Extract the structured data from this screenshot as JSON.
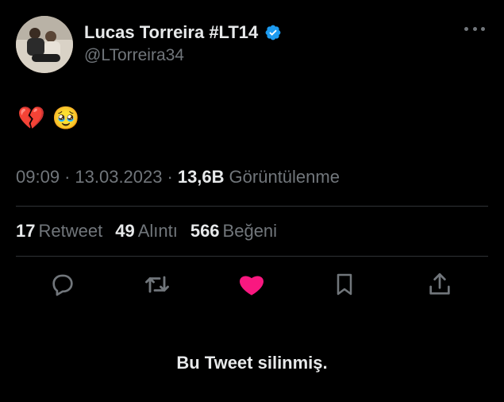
{
  "author": {
    "name": "Lucas Torreira #LT14",
    "handle": "@LTorreira34",
    "verified_color": "#1d9bf0"
  },
  "tweet": {
    "text": "💔 🥹",
    "time": "09:09",
    "date": "13.03.2023",
    "views_count": "13,6B",
    "views_label": "Görüntülenme"
  },
  "stats": {
    "retweets": {
      "count": "17",
      "label": "Retweet"
    },
    "quotes": {
      "count": "49",
      "label": "Alıntı"
    },
    "likes": {
      "count": "566",
      "label": "Beğeni"
    }
  },
  "actions": {
    "reply_icon": "reply-icon",
    "retweet_icon": "retweet-icon",
    "like_icon": "heart-icon",
    "bookmark_icon": "bookmark-icon",
    "share_icon": "share-icon",
    "like_color": "#f91880"
  },
  "footer": {
    "deleted_notice": "Bu Tweet silinmiş."
  }
}
